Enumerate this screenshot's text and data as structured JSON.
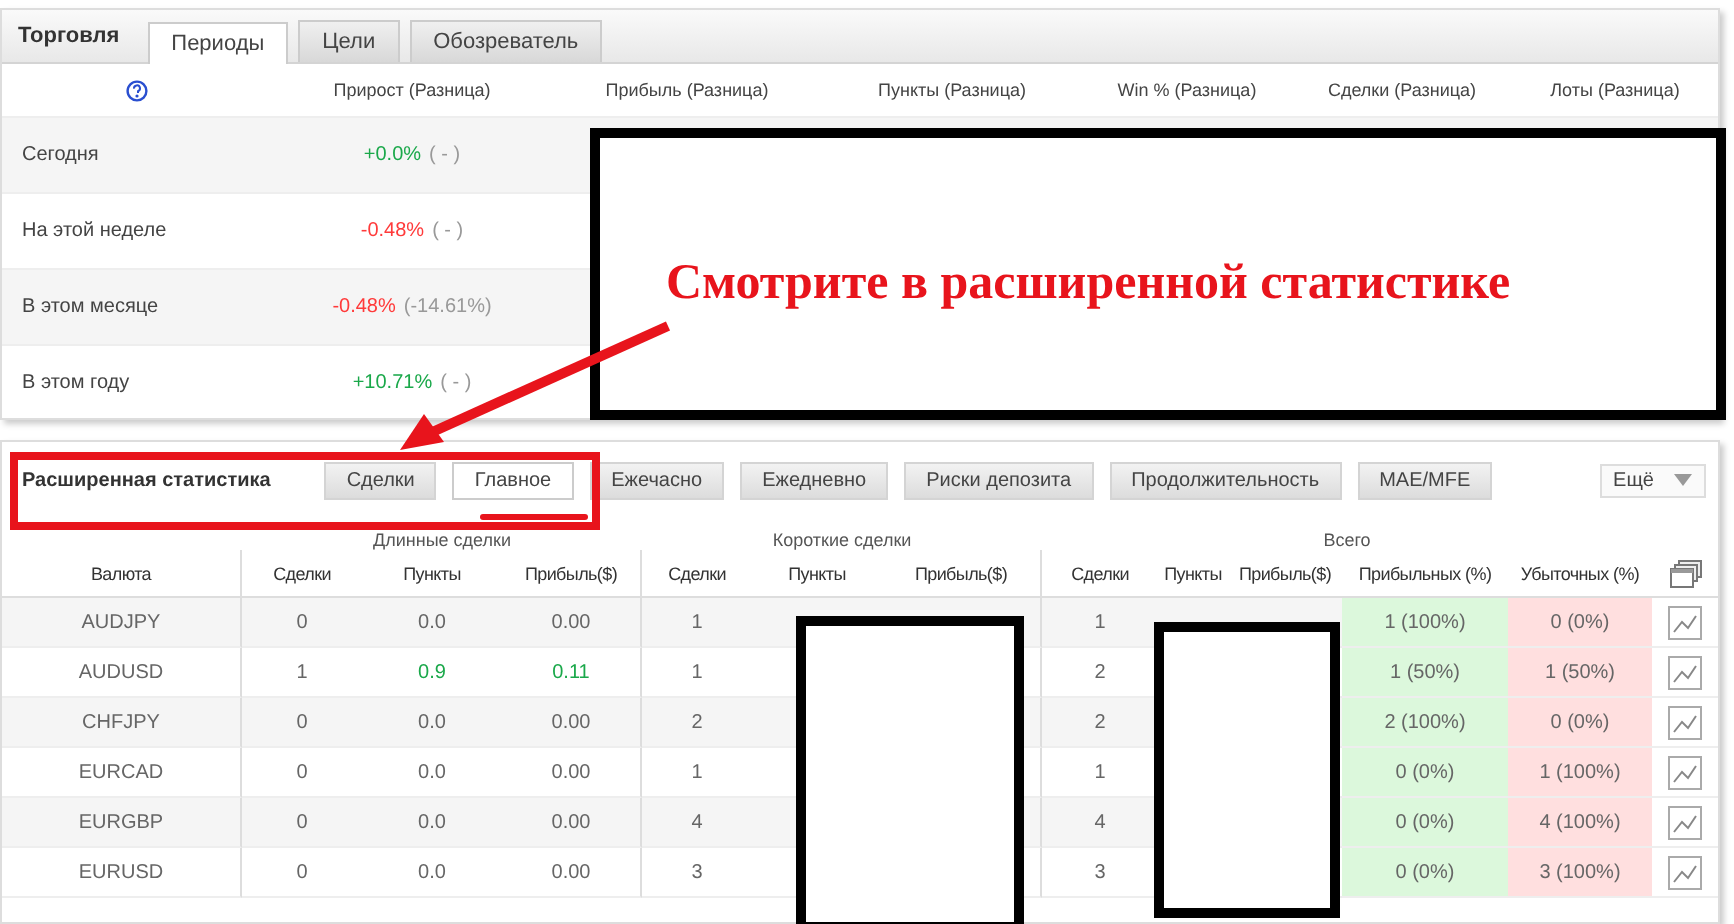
{
  "trading": {
    "title": "Торговля",
    "tabs": [
      {
        "label": "Периоды",
        "selected": true
      },
      {
        "label": "Цели",
        "selected": false
      },
      {
        "label": "Обозреватель",
        "selected": false
      }
    ],
    "columns": [
      "Прирост (Разница)",
      "Прибыль (Разница)",
      "Пункты (Разница)",
      "Win % (Разница)",
      "Сделки (Разница)",
      "Лоты (Разница)"
    ],
    "rows": [
      {
        "period": "Сегодня",
        "growth": "+0.0%",
        "color": "#1aa84a",
        "difference": "( - )"
      },
      {
        "period": "На этой неделе",
        "growth": "-0.48%",
        "color": "#ff3a3a",
        "difference": "( - )"
      },
      {
        "period": "В этом месяце",
        "growth": "-0.48%",
        "color": "#ff3a3a",
        "difference": "(-14.61%)"
      },
      {
        "period": "В этом году",
        "growth": "+10.71%",
        "color": "#1aa84a",
        "difference": "( - )"
      }
    ]
  },
  "annotation": {
    "text": "Смотрите в расширенной статистике"
  },
  "extended": {
    "title": "Расширенная статистика",
    "tabs": [
      {
        "label": "Сделки",
        "selected": false
      },
      {
        "label": "Главное",
        "selected": true
      },
      {
        "label": "Ежечасно",
        "selected": false
      },
      {
        "label": "Ежедневно",
        "selected": false
      },
      {
        "label": "Риски депозита",
        "selected": false
      },
      {
        "label": "Продолжительность",
        "selected": false
      },
      {
        "label": "MAE/MFE",
        "selected": false
      }
    ],
    "more": "Ещё",
    "groups": [
      "Длинные сделки",
      "Короткие сделки",
      "Всего"
    ],
    "columns": [
      "Валюта",
      "Сделки",
      "Пункты",
      "Прибыль($)",
      "Сделки",
      "Пункты",
      "Прибыль($)",
      "Сделки",
      "Пункты",
      "Прибыль($)",
      "Прибыльных (%)",
      "Убыточных (%)"
    ],
    "rows": [
      {
        "currency": "AUDJPY",
        "long_deals": "0",
        "long_points": "0.0",
        "long_profit": "0.00",
        "long_positive": false,
        "short_deals": "1",
        "total_deals": "1",
        "profitable": "1 (100%)",
        "losing": "0 (0%)"
      },
      {
        "currency": "AUDUSD",
        "long_deals": "1",
        "long_points": "0.9",
        "long_profit": "0.11",
        "long_positive": true,
        "short_deals": "1",
        "total_deals": "2",
        "profitable": "1 (50%)",
        "losing": "1 (50%)"
      },
      {
        "currency": "CHFJPY",
        "long_deals": "0",
        "long_points": "0.0",
        "long_profit": "0.00",
        "long_positive": false,
        "short_deals": "2",
        "total_deals": "2",
        "profitable": "2 (100%)",
        "losing": "0 (0%)"
      },
      {
        "currency": "EURCAD",
        "long_deals": "0",
        "long_points": "0.0",
        "long_profit": "0.00",
        "long_positive": false,
        "short_deals": "1",
        "total_deals": "1",
        "profitable": "0 (0%)",
        "losing": "1 (100%)"
      },
      {
        "currency": "EURGBP",
        "long_deals": "0",
        "long_points": "0.0",
        "long_profit": "0.00",
        "long_positive": false,
        "short_deals": "4",
        "total_deals": "4",
        "profitable": "0 (0%)",
        "losing": "4 (100%)"
      },
      {
        "currency": "EURUSD",
        "long_deals": "0",
        "long_points": "0.0",
        "long_profit": "0.00",
        "long_positive": false,
        "short_deals": "3",
        "total_deals": "3",
        "profitable": "0 (0%)",
        "losing": "3 (100%)"
      }
    ]
  }
}
